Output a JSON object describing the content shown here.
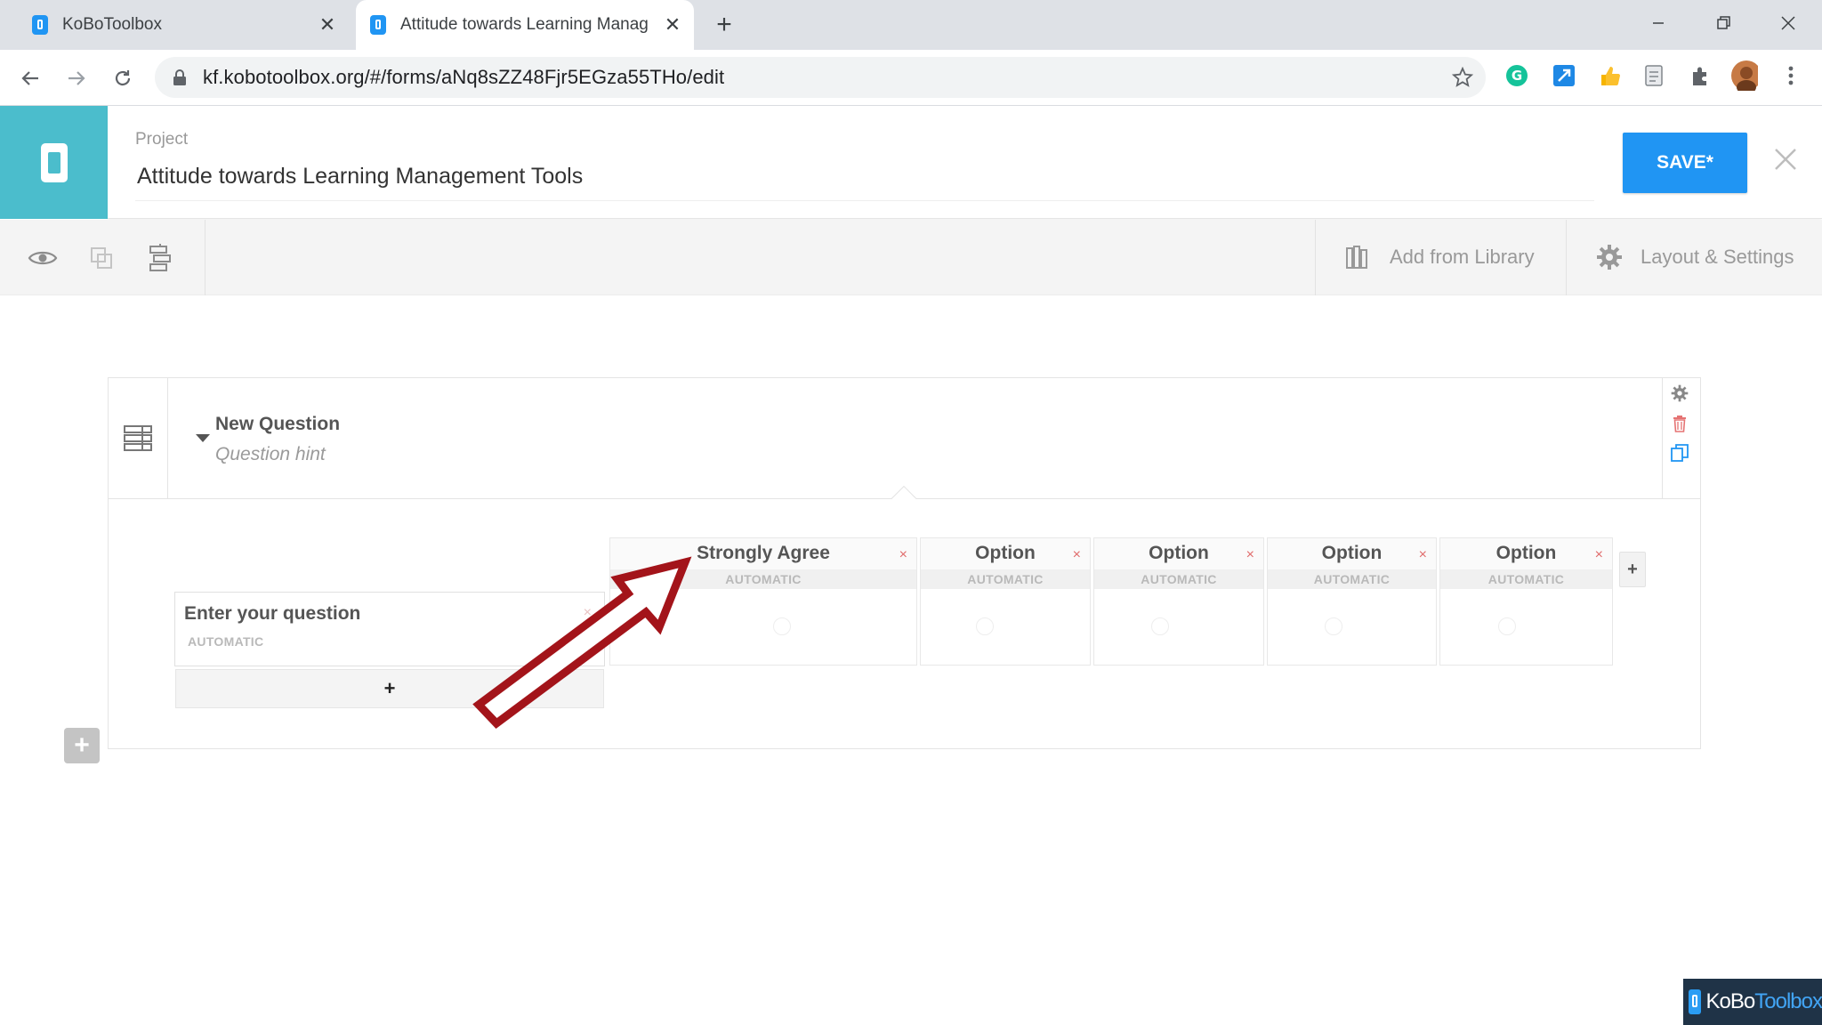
{
  "browser": {
    "tabs": [
      {
        "title": "KoBoToolbox",
        "active": false
      },
      {
        "title": "Attitude towards Learning Manag",
        "active": true
      }
    ],
    "url": "kf.kobotoolbox.org/#/forms/aNq8sZZ48Fjr5EGza55THo/edit"
  },
  "header": {
    "project_label": "Project",
    "project_title": "Attitude towards Learning Management Tools",
    "save_label": "SAVE*"
  },
  "toolbar": {
    "add_from_library": "Add from Library",
    "layout_settings": "Layout & Settings"
  },
  "question": {
    "label": "New Question",
    "hint": "Question hint",
    "columns": [
      {
        "label": "Strongly Agree",
        "auto": "AUTOMATIC"
      },
      {
        "label": "Option",
        "auto": "AUTOMATIC"
      },
      {
        "label": "Option",
        "auto": "AUTOMATIC"
      },
      {
        "label": "Option",
        "auto": "AUTOMATIC"
      },
      {
        "label": "Option",
        "auto": "AUTOMATIC"
      }
    ],
    "rows": [
      {
        "label": "Enter your question",
        "auto": "AUTOMATIC"
      }
    ],
    "add_row_label": "+",
    "add_column_label": "+"
  },
  "watermark": {
    "part1": "KoBo",
    "part2": "Toolbox"
  },
  "colors": {
    "brand_teal": "#4bbdcc",
    "save_blue": "#2095f3",
    "annotation_red": "#a3141a"
  }
}
